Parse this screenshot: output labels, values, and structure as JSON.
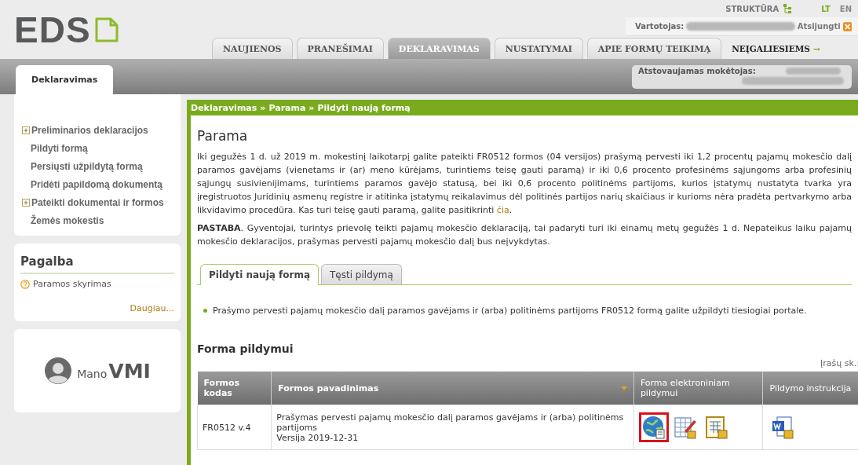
{
  "header": {
    "logo": "EDS",
    "structure_link": "STRUKTŪRA",
    "languages": [
      {
        "label": "LT",
        "selected": true
      },
      {
        "label": "EN",
        "selected": false
      }
    ],
    "user_label": "Vartotojas:",
    "logout": "Atsijungti",
    "nav_tabs": [
      {
        "label": "NAUJIENOS",
        "selected": false
      },
      {
        "label": "PRANEŠIMAI",
        "selected": false
      },
      {
        "label": "DEKLARAVIMAS",
        "selected": true
      },
      {
        "label": "NUSTATYMAI",
        "selected": false
      },
      {
        "label": "APIE FORMŲ TEIKIMĄ",
        "selected": false
      }
    ],
    "accessibility_link": "NEĮGALIESIEMS",
    "accessibility_arrow": "→"
  },
  "subbar": {
    "tab": "Deklaravimas",
    "payer_label": "Atstovaujamas mokėtojas:"
  },
  "sidebar": {
    "items": [
      {
        "label": "Preliminarios deklaracijos",
        "expandable": true
      },
      {
        "label": "Pildyti formą",
        "expandable": false
      },
      {
        "label": "Persiųsti užpildytą formą",
        "expandable": false
      },
      {
        "label": "Pridėti papildomą dokumentą",
        "expandable": false
      },
      {
        "label": "Pateikti dokumentai ir formos",
        "expandable": true
      },
      {
        "label": "Žemės mokestis",
        "expandable": false
      }
    ],
    "help": {
      "title": "Pagalba",
      "items": [
        "Paramos skyrimas"
      ],
      "more": "Daugiau..."
    },
    "promo": {
      "prefix": "Mano",
      "name": "VMI"
    }
  },
  "content": {
    "breadcrumb": [
      "Deklaravimas",
      "Parama",
      "Pildyti naują formą"
    ],
    "breadcrumb_separator": "»",
    "title": "Parama",
    "intro": "Iki gegužės 1 d. už 2019 m. mokestinį laikotarpį galite pateikti FR0512 formos (04 versijos) prašymą pervesti iki 1,2 procentų pajamų mokesčio dalį paramos gavėjams (vienetams ir (ar) meno kūrėjams, turintiems teisę gauti paramą) ir iki 0,6 procento profesinėms sąjungoms arba profesinių sąjungų susivienijimams, turintiems paramos gavėjo statusą, bei iki 0,6 procento politinėms partijoms, kurios įstatymų nustatyta tvarka yra įregistruotos Juridinių asmenų registre ir atitinka įstatymų reikalavimus dėl politinės partijos narių skaičiaus ir kurioms nėra pradėta pertvarkymo arba likvidavimo procedūra. Kas turi teisę gauti paramą, galite pasitikrinti",
    "intro_link": "čia",
    "intro_end": ".",
    "note": "**PASTABA**. Gyventojai, turintys prievolę teikti pajamų mokesčio deklaraciją, tai padaryti turi iki einamų metų gegužės 1 d. Nepateikus laiku pajamų mokesčio deklaracijos, prašymas pervesti pajamų mokesčio dalį bus neįvykdytas.",
    "tabs": [
      {
        "label": "Pildyti naują formą",
        "selected": true
      },
      {
        "label": "Tęsti pildymą",
        "selected": false
      }
    ],
    "bullets": [
      "Prašymo pervesti pajamų mokesčio dalį paramos gavėjams ir (arba) politinėms partijoms FR0512 formą galite užpildyti tiesiogiai portale."
    ],
    "section_title": "Forma pildymui",
    "record_count": "Įrašų sk.:",
    "table": {
      "columns": [
        {
          "label": "Formos kodas",
          "sorted": false
        },
        {
          "label": "Formos pavadinimas",
          "sorted": true
        },
        {
          "label": "Forma elektroniniam pildymui",
          "sorted": false
        },
        {
          "label": "Pildymo instrukcija",
          "sorted": false
        }
      ],
      "rows": [
        {
          "code": "FR0512 v.4",
          "name": "Prašymas pervesti pajamų mokesčio dalį paramos gavėjams ir (arba) politinėms partijoms",
          "version": "Versija 2019-12-31",
          "form_icons": [
            {
              "kind": "globe",
              "highlighted": true
            },
            {
              "kind": "sheet-edit",
              "highlighted": false
            },
            {
              "kind": "sheet",
              "highlighted": false
            }
          ],
          "instruction_icons": [
            {
              "kind": "word",
              "highlighted": false
            }
          ]
        }
      ]
    }
  }
}
